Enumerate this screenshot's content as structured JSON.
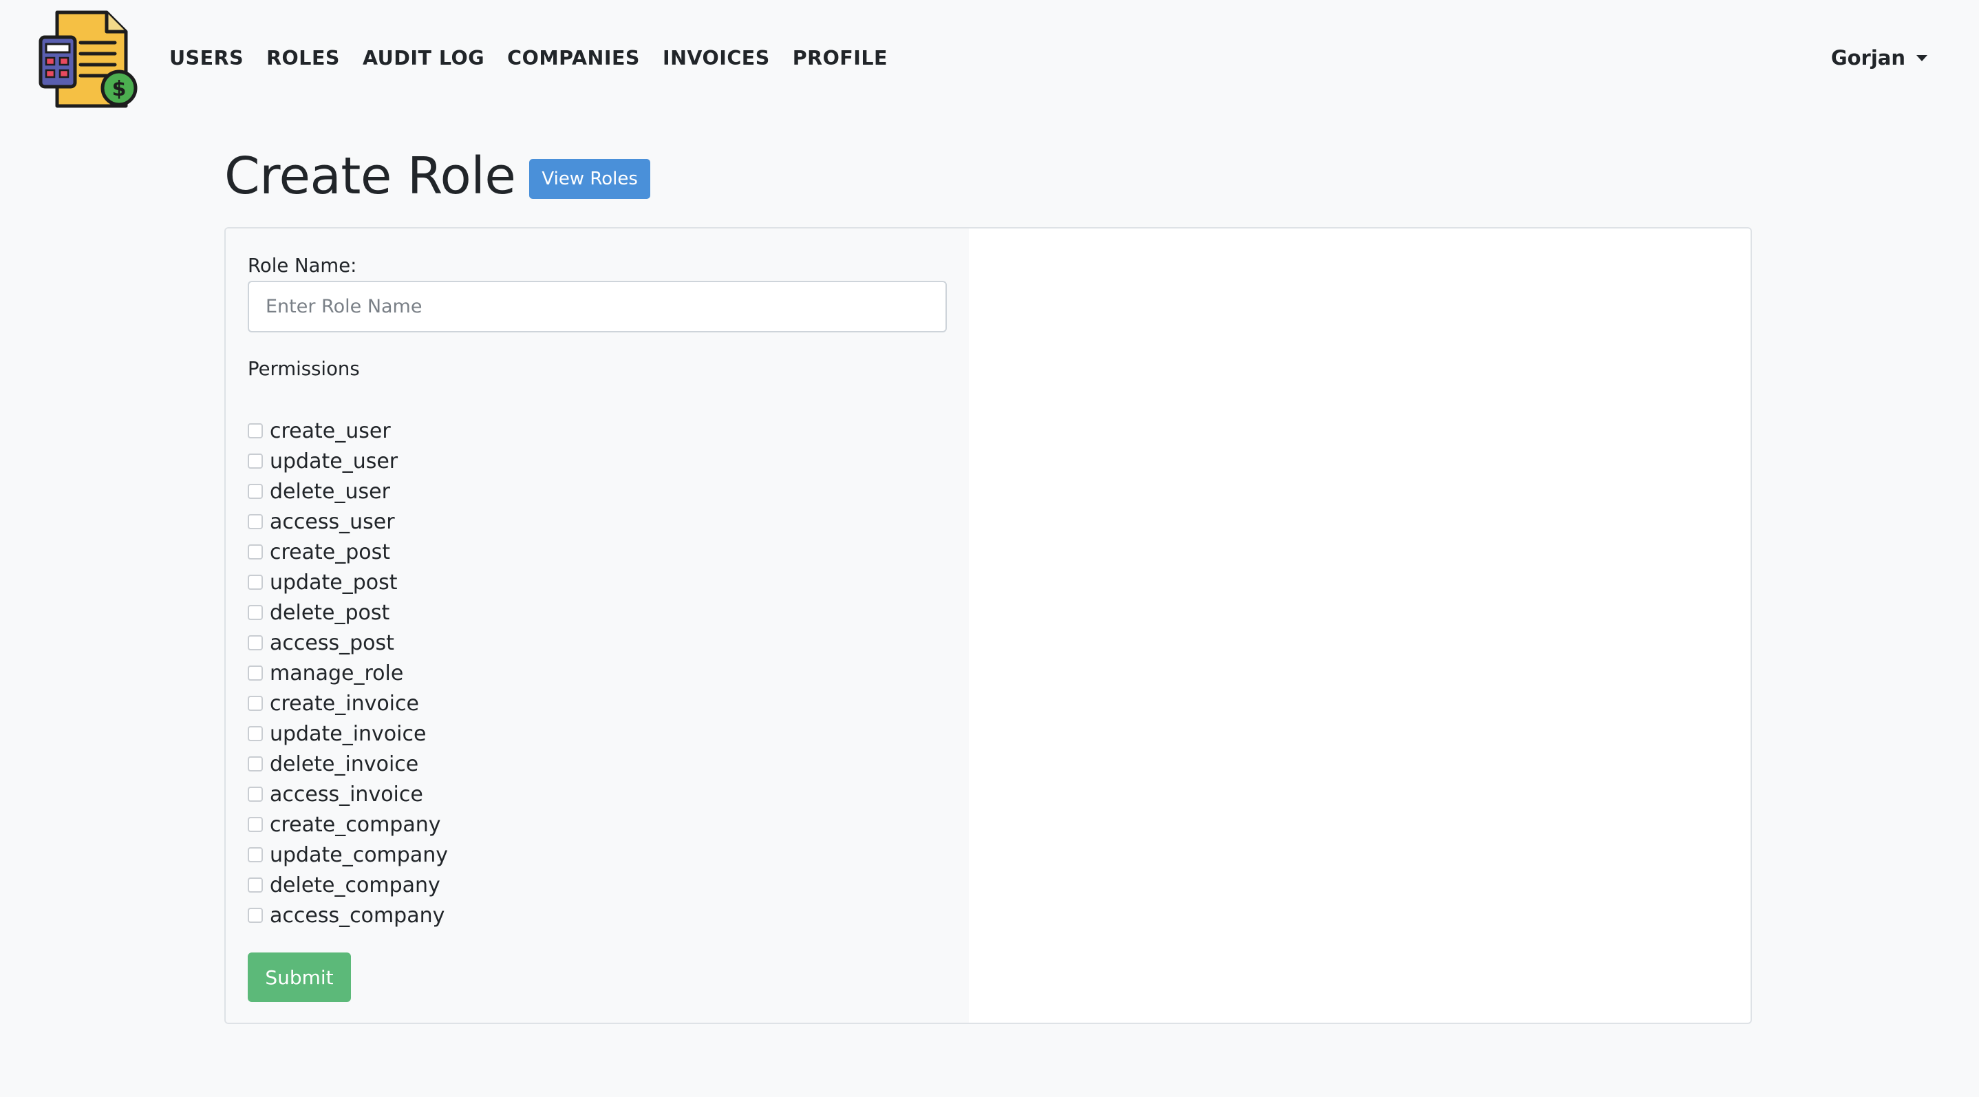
{
  "navbar": {
    "logo_icon": "invoice-calculator-dollar-icon",
    "links": [
      {
        "label": "USERS"
      },
      {
        "label": "ROLES"
      },
      {
        "label": "AUDIT LOG"
      },
      {
        "label": "COMPANIES"
      },
      {
        "label": "INVOICES"
      },
      {
        "label": "PROFILE"
      }
    ],
    "user_name": "Gorjan"
  },
  "header": {
    "title": "Create Role",
    "view_roles_label": "View Roles"
  },
  "form": {
    "role_name_label": "Role Name:",
    "role_name_placeholder": "Enter Role Name",
    "role_name_value": "",
    "permissions_label": "Permissions",
    "permissions": [
      {
        "name": "create_user",
        "checked": false
      },
      {
        "name": "update_user",
        "checked": false
      },
      {
        "name": "delete_user",
        "checked": false
      },
      {
        "name": "access_user",
        "checked": false
      },
      {
        "name": "create_post",
        "checked": false
      },
      {
        "name": "update_post",
        "checked": false
      },
      {
        "name": "delete_post",
        "checked": false
      },
      {
        "name": "access_post",
        "checked": false
      },
      {
        "name": "manage_role",
        "checked": false
      },
      {
        "name": "create_invoice",
        "checked": false
      },
      {
        "name": "update_invoice",
        "checked": false
      },
      {
        "name": "delete_invoice",
        "checked": false
      },
      {
        "name": "access_invoice",
        "checked": false
      },
      {
        "name": "create_company",
        "checked": false
      },
      {
        "name": "update_company",
        "checked": false
      },
      {
        "name": "delete_company",
        "checked": false
      },
      {
        "name": "access_company",
        "checked": false
      }
    ],
    "submit_label": "Submit"
  },
  "colors": {
    "primary_button": "#4a90d9",
    "submit_button": "#5cb979",
    "page_background": "#f8f9fa"
  }
}
